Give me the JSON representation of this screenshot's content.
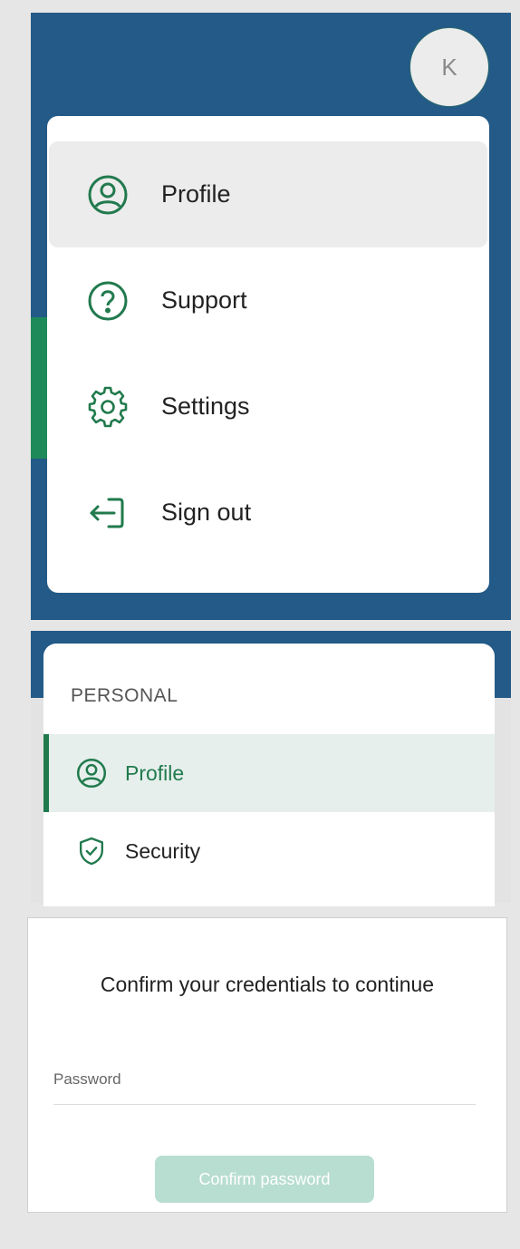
{
  "colors": {
    "header_blue": "#235a87",
    "brand_green": "#217a4d",
    "active_row_bg": "#e6efec",
    "disabled_button": "#b8ded1"
  },
  "account": {
    "avatar_initial": "K"
  },
  "menu": {
    "items": [
      {
        "label": "Profile",
        "icon": "user-circle-icon",
        "active": true
      },
      {
        "label": "Support",
        "icon": "question-circle-icon",
        "active": false
      },
      {
        "label": "Settings",
        "icon": "gear-icon",
        "active": false
      },
      {
        "label": "Sign out",
        "icon": "sign-out-icon",
        "active": false
      }
    ]
  },
  "sidebar": {
    "section_label": "PERSONAL",
    "items": [
      {
        "label": "Profile",
        "icon": "user-circle-icon",
        "active": true
      },
      {
        "label": "Security",
        "icon": "shield-check-icon",
        "active": false
      }
    ]
  },
  "confirm": {
    "title": "Confirm your credentials to continue",
    "password_label": "Password",
    "password_value": "",
    "button_label": "Confirm password"
  }
}
